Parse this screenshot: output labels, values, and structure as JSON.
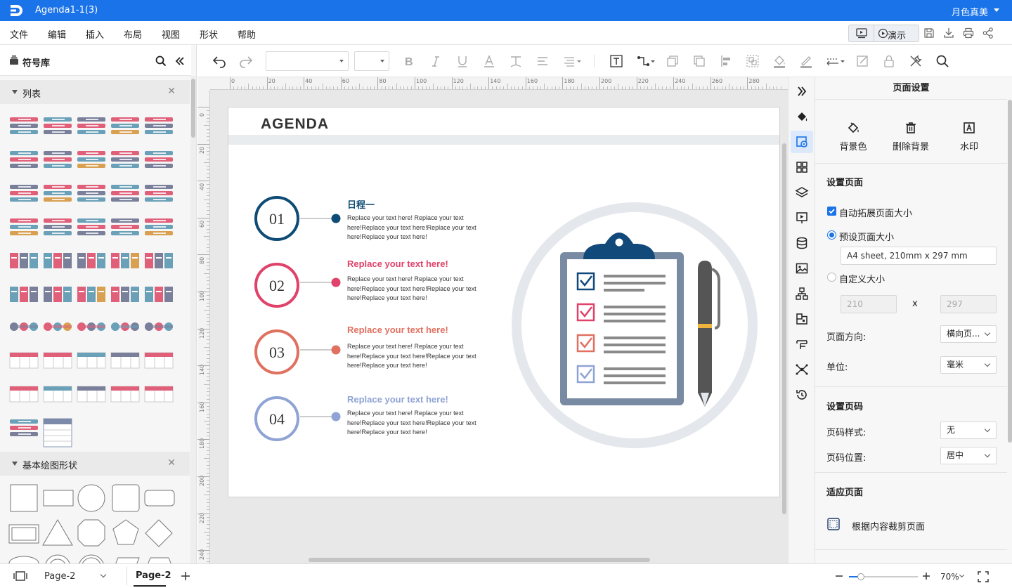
{
  "titlebar": {
    "doc_title": "Agenda1-1(3)",
    "user_name": "月色真美"
  },
  "menu": {
    "items": [
      "文件",
      "编辑",
      "插入",
      "布局",
      "视图",
      "形状",
      "帮助"
    ],
    "present_label": "演示"
  },
  "left_panel": {
    "title": "符号库",
    "section_list": "列表",
    "section_basic": "基本绘图形状"
  },
  "ruler": {
    "top": [
      "0",
      "20",
      "40",
      "60",
      "80",
      "100",
      "120",
      "140",
      "160",
      "180",
      "200",
      "220",
      "240",
      "260",
      "280"
    ],
    "left": [
      "0",
      "20",
      "40",
      "60",
      "80",
      "100",
      "120",
      "140",
      "160",
      "180",
      "200",
      "220",
      "240"
    ]
  },
  "canvas": {
    "agenda_title": "AGENDA",
    "items": [
      {
        "num": "01",
        "heading": "日程一",
        "color": "#0f4c75",
        "body": "Replace your text here!  Replace your text here!Replace your text here!Replace your text here!Replace your text here!"
      },
      {
        "num": "02",
        "heading": "Replace your text here!",
        "color": "#e0426a",
        "body": "Replace your text here!  Replace your text here!Replace your text here!Replace your text here!Replace your text here!"
      },
      {
        "num": "03",
        "heading": "Replace your text here!",
        "color": "#e07060",
        "body": "Replace your text here!  Replace your text here!Replace your text here!Replace your text here!Replace your text here!"
      },
      {
        "num": "04",
        "heading": "Replace your text here!",
        "color": "#8fa4d4",
        "body": "Replace your text here!  Replace your text here!Replace your text here!Replace your text here!Replace your text here!"
      }
    ]
  },
  "right_panel": {
    "title": "页面设置",
    "actions": {
      "bg_color": "背景色",
      "remove_bg": "删除背景",
      "watermark": "水印"
    },
    "page_setup": {
      "heading": "设置页面",
      "auto_expand": "自动拓展页面大小",
      "preset_size": "预设页面大小",
      "preset_value": "A4 sheet, 210mm x 297 mm",
      "custom_size": "自定义大小",
      "width_value": "210",
      "x_label": "x",
      "height_value": "297",
      "orientation_label": "页面方向:",
      "orientation_value": "横向页...",
      "unit_label": "单位:",
      "unit_value": "毫米"
    },
    "page_number": {
      "heading": "设置页码",
      "style_label": "页码样式:",
      "style_value": "无",
      "position_label": "页码位置:",
      "position_value": "居中"
    },
    "fit_page": {
      "heading": "适应页面",
      "crop_label": "根据内容裁剪页面"
    }
  },
  "statusbar": {
    "page_select": "Page-2",
    "page_tab": "Page-2",
    "zoom": "70%"
  },
  "colors": {
    "accent": "#1a73e8",
    "navy": "#0f4c75",
    "pink": "#e0426a",
    "coral": "#e07060",
    "lavender": "#8fa4d4"
  }
}
